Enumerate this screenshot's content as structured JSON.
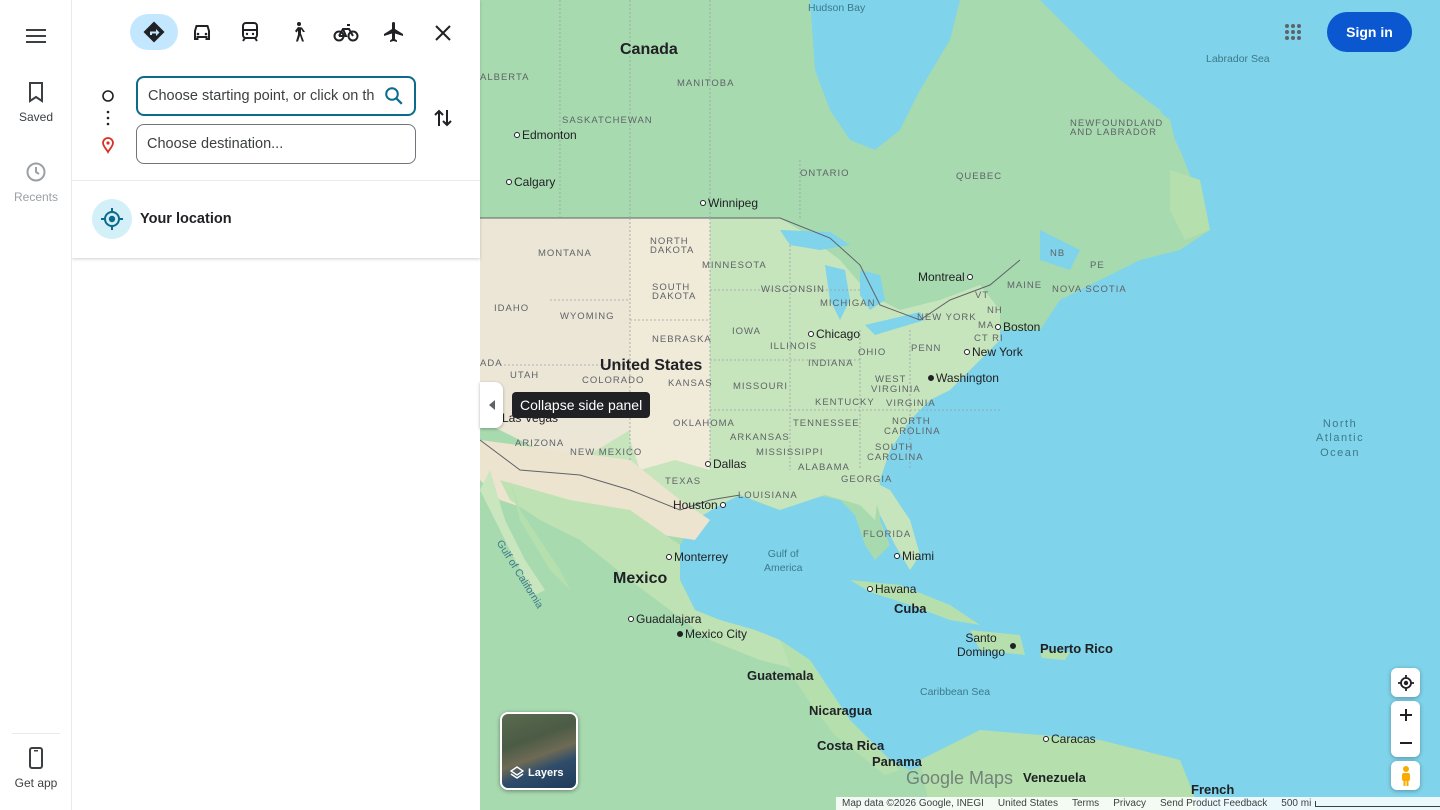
{
  "rail": {
    "saved": "Saved",
    "recents": "Recents",
    "get_app": "Get app"
  },
  "directions": {
    "modes": [
      "best-route",
      "driving",
      "transit",
      "walking",
      "cycling",
      "flights"
    ],
    "start_placeholder": "Choose starting point, or click on th",
    "destination_placeholder": "Choose destination...",
    "your_location": "Your location"
  },
  "map": {
    "tooltip": "Collapse side panel",
    "sign_in": "Sign in",
    "layers_label": "Layers",
    "logo": "Google Maps",
    "footer": {
      "map_data": "Map data ©2026 Google, INEGI",
      "region": "United States",
      "terms": "Terms",
      "privacy": "Privacy",
      "feedback": "Send Product Feedback",
      "scale": "500 mi"
    },
    "labels": {
      "hudson_bay": "Hudson Bay",
      "canada": "Canada",
      "labrador_sea": "Labrador Sea",
      "alberta": "ALBERTA",
      "manitoba": "MANITOBA",
      "saskatchewan": "SASKATCHEWAN",
      "edmonton": "Edmonton",
      "newfoundland1": "NEWFOUNDLAND",
      "newfoundland2": "AND LABRADOR",
      "ontario": "ONTARIO",
      "quebec": "QUEBEC",
      "calgary": "Calgary",
      "winnipeg": "Winnipeg",
      "north_dakota1": "NORTH",
      "north_dakota2": "DAKOTA",
      "montana": "MONTANA",
      "minnesota": "MINNESOTA",
      "nb": "NB",
      "pe": "PE",
      "montreal": "Montreal",
      "maine": "MAINE",
      "nova_scotia": "NOVA SCOTIA",
      "vt": "VT",
      "nh": "NH",
      "south_dakota1": "SOUTH",
      "south_dakota2": "DAKOTA",
      "wisconsin": "WISCONSIN",
      "michigan": "MICHIGAN",
      "idaho": "IDAHO",
      "wyoming": "WYOMING",
      "new_york_state": "NEW YORK",
      "ma": "MA",
      "boston": "Boston",
      "ct_ri": "CT RI",
      "iowa": "IOWA",
      "chicago": "Chicago",
      "nebraska": "NEBRASKA",
      "illinois": "ILLINOIS",
      "ohio": "OHIO",
      "penn": "PENN",
      "new_york": "New York",
      "ada": "ADA",
      "utah": "UTAH",
      "united_states": "United States",
      "colorado": "COLORADO",
      "kansas": "KANSAS",
      "missouri": "MISSOURI",
      "indiana": "INDIANA",
      "west_virginia1": "WEST",
      "west_virginia2": "VIRGINIA",
      "washington": "Washington",
      "kentucky": "KENTUCKY",
      "virginia": "VIRGINIA",
      "las_vegas": "Las Vegas",
      "oklahoma": "OKLAHOMA",
      "tennessee": "TENNESSEE",
      "north_carolina1": "NORTH",
      "north_carolina2": "CAROLINA",
      "north_atlantic1": "North",
      "north_atlantic2": "Atlantic",
      "north_atlantic3": "Ocean",
      "arizona": "ARIZONA",
      "new_mexico": "NEW MEXICO",
      "arkansas": "ARKANSAS",
      "mississippi": "MISSISSIPPI",
      "south_carolina1": "SOUTH",
      "south_carolina2": "CAROLINA",
      "dallas": "Dallas",
      "alabama": "ALABAMA",
      "georgia": "GEORGIA",
      "texas": "TEXAS",
      "louisiana": "LOUISIANA",
      "houston": "Houston",
      "gulf_california": "Gulf of California",
      "florida": "FLORIDA",
      "gulf_america1": "Gulf of",
      "gulf_america2": "America",
      "monterrey": "Monterrey",
      "miami": "Miami",
      "mexico": "Mexico",
      "havana": "Havana",
      "cuba": "Cuba",
      "guadalajara": "Guadalajara",
      "mexico_city": "Mexico City",
      "santo_domingo1": "Santo",
      "santo_domingo2": "Domingo",
      "puerto_rico": "Puerto Rico",
      "guatemala": "Guatemala",
      "caribbean_sea": "Caribbean Sea",
      "nicaragua": "Nicaragua",
      "costa_rica": "Costa Rica",
      "caracas": "Caracas",
      "panama": "Panama",
      "venezuela": "Venezuela",
      "french": "French"
    }
  }
}
